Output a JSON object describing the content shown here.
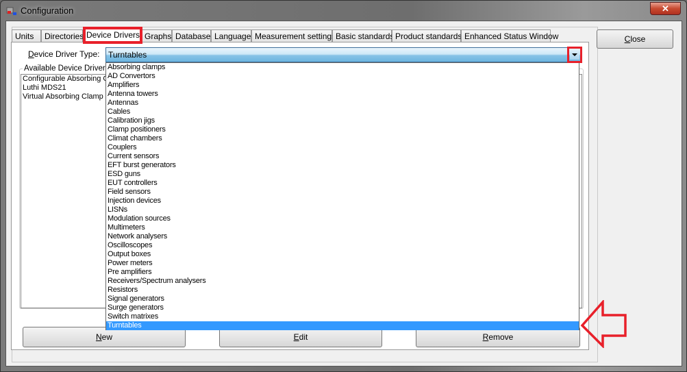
{
  "window": {
    "title": "Configuration",
    "close_glyph": "✕"
  },
  "tabs": [
    {
      "label": "Units"
    },
    {
      "label": "Directories"
    },
    {
      "label": "Device Drivers",
      "active": true
    },
    {
      "label": "Graphs"
    },
    {
      "label": "Database"
    },
    {
      "label": "Language"
    },
    {
      "label": "Measurement settings"
    },
    {
      "label": "Basic standards"
    },
    {
      "label": "Product standards"
    },
    {
      "label": "Enhanced Status Window"
    }
  ],
  "close_button": {
    "underline": "C",
    "rest": "lose"
  },
  "device_driver_type": {
    "label_underline": "D",
    "label_rest": "evice Driver Type:",
    "value": "Turntables"
  },
  "available": {
    "label": "Available Device Drivers",
    "items": [
      "Configurable Absorbing Clamp",
      "Luthi MDS21",
      "Virtual Absorbing Clamp"
    ]
  },
  "dropdown_options": [
    "Absorbing clamps",
    "AD Convertors",
    "Amplifiers",
    "Antenna towers",
    "Antennas",
    "Cables",
    "Calibration jigs",
    "Clamp positioners",
    "Climat chambers",
    "Couplers",
    "Current sensors",
    "EFT burst generators",
    "ESD guns",
    "EUT controllers",
    "Field sensors",
    "Injection devices",
    "LISNs",
    "Modulation sources",
    "Multimeters",
    "Network analysers",
    "Oscilloscopes",
    "Output boxes",
    "Power meters",
    "Pre amplifiers",
    "Receivers/Spectrum analysers",
    "Resistors",
    "Signal generators",
    "Surge generators",
    "Switch matrixes",
    "Turntables"
  ],
  "selected_option": "Turntables",
  "buttons": {
    "new": {
      "underline": "N",
      "rest": "ew"
    },
    "edit": {
      "underline": "E",
      "rest": "dit"
    },
    "remove": {
      "underline": "R",
      "rest": "emove"
    }
  },
  "colors": {
    "highlight": "#3399ff",
    "annotation": "#e8202a"
  }
}
